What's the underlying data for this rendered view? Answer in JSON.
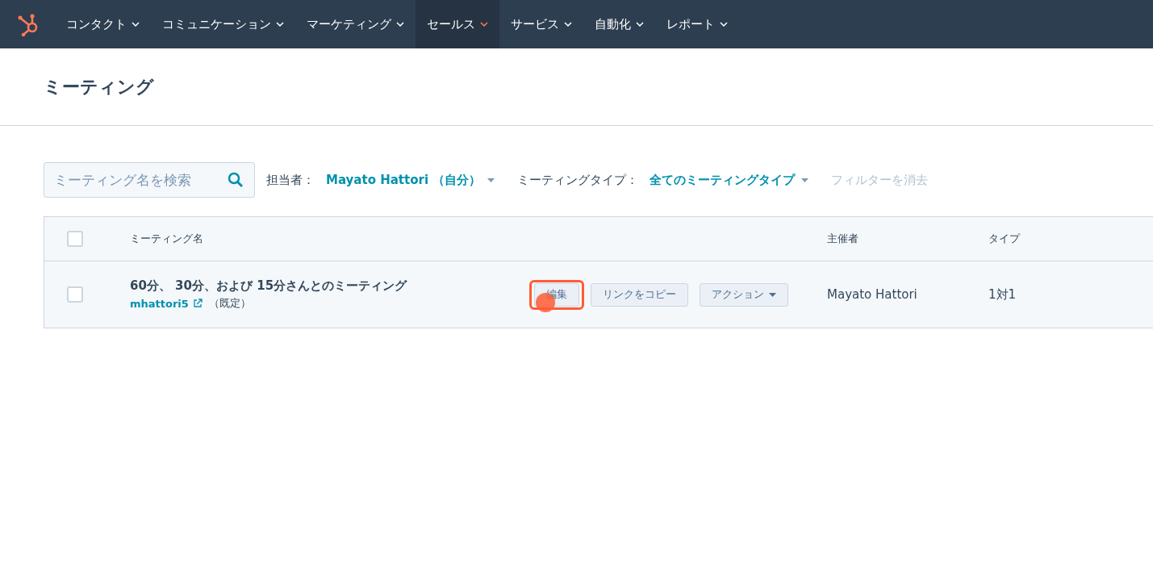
{
  "nav": {
    "items": [
      {
        "label": "コンタクト",
        "selected": false
      },
      {
        "label": "コミュニケーション",
        "selected": false
      },
      {
        "label": "マーケティング",
        "selected": false
      },
      {
        "label": "セールス",
        "selected": true
      },
      {
        "label": "サービス",
        "selected": false
      },
      {
        "label": "自動化",
        "selected": false
      },
      {
        "label": "レポート",
        "selected": false
      }
    ]
  },
  "page": {
    "title": "ミーティング"
  },
  "filters": {
    "search": {
      "placeholder": "ミーティング名を検索"
    },
    "owner": {
      "label": "担当者：",
      "value": "Mayato Hattori （自分）"
    },
    "type": {
      "label": "ミーティングタイプ：",
      "value": "全てのミーティングタイプ"
    },
    "clear": "フィルターを消去"
  },
  "table": {
    "columns": [
      "ミーティング名",
      "主催者",
      "タイプ"
    ],
    "all_checked": false,
    "rows": [
      {
        "checked": false,
        "name": "60分、 30分、および 15分さんとのミーティング",
        "link": "mhattori5",
        "note": "（既定）",
        "edit": "編集",
        "copy": "リンクをコピー",
        "actions": "アクション",
        "highlighted": true,
        "host": "Mayato Hattori",
        "type": "1対1"
      }
    ]
  }
}
